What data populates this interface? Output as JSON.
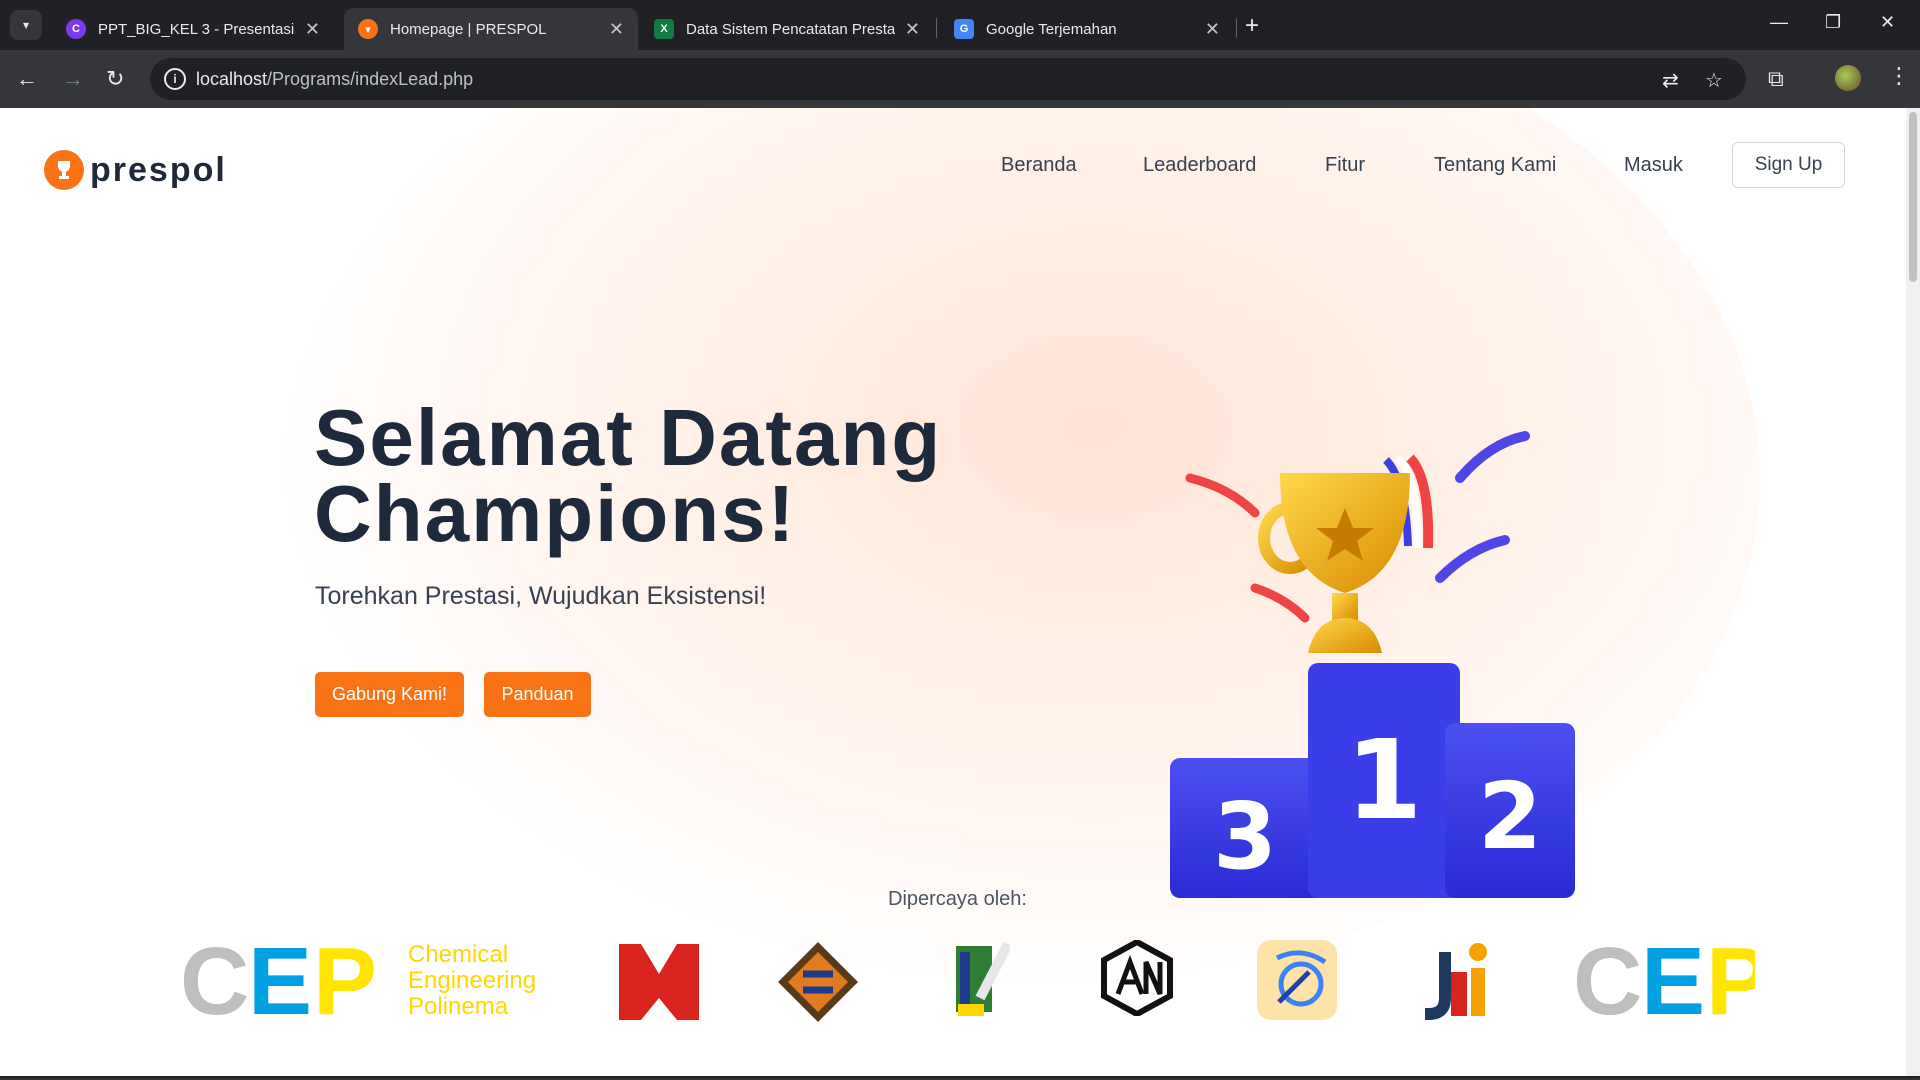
{
  "browser": {
    "tabs": [
      {
        "title": "PPT_BIG_KEL 3 - Presentasi",
        "active": false,
        "favicon": "canva-icon",
        "color": "#7c3aed"
      },
      {
        "title": "Homepage | PRESPOL",
        "active": true,
        "favicon": "prespol-trophy-icon",
        "color": "#f97316"
      },
      {
        "title": "Data Sistem Pencatatan Prestasi",
        "active": false,
        "favicon": "excel-icon",
        "color": "#107c41"
      },
      {
        "title": "Google Terjemahan",
        "active": false,
        "favicon": "google-translate-icon",
        "color": "#4285f4"
      }
    ],
    "url_host": "localhost",
    "url_path": "/Programs/indexLead.php"
  },
  "site": {
    "logo_text": "prespol",
    "nav": [
      "Beranda",
      "Leaderboard",
      "Fitur",
      "Tentang Kami",
      "Masuk"
    ],
    "signup_label": "Sign Up",
    "accent": "#f97316"
  },
  "hero": {
    "title_line1": "Selamat Datang",
    "title_line2": "Champions!",
    "subtitle": "Torehkan Prestasi, Wujudkan Eksistensi!",
    "join_label": "Gabung Kami!",
    "guide_label": "Panduan",
    "podium_numbers": [
      "3",
      "1",
      "2"
    ]
  },
  "trusted": {
    "label": "Dipercaya oleh:",
    "cep_text": "CEP",
    "cep_sub": [
      "Chemical",
      "Engineering",
      "Polinema"
    ],
    "logos": [
      "cep-logo",
      "m-logo",
      "diamond-logo",
      "pen-logo",
      "an-logo",
      "signal-logo",
      "ji-logo",
      "cep-logo-repeat"
    ]
  }
}
